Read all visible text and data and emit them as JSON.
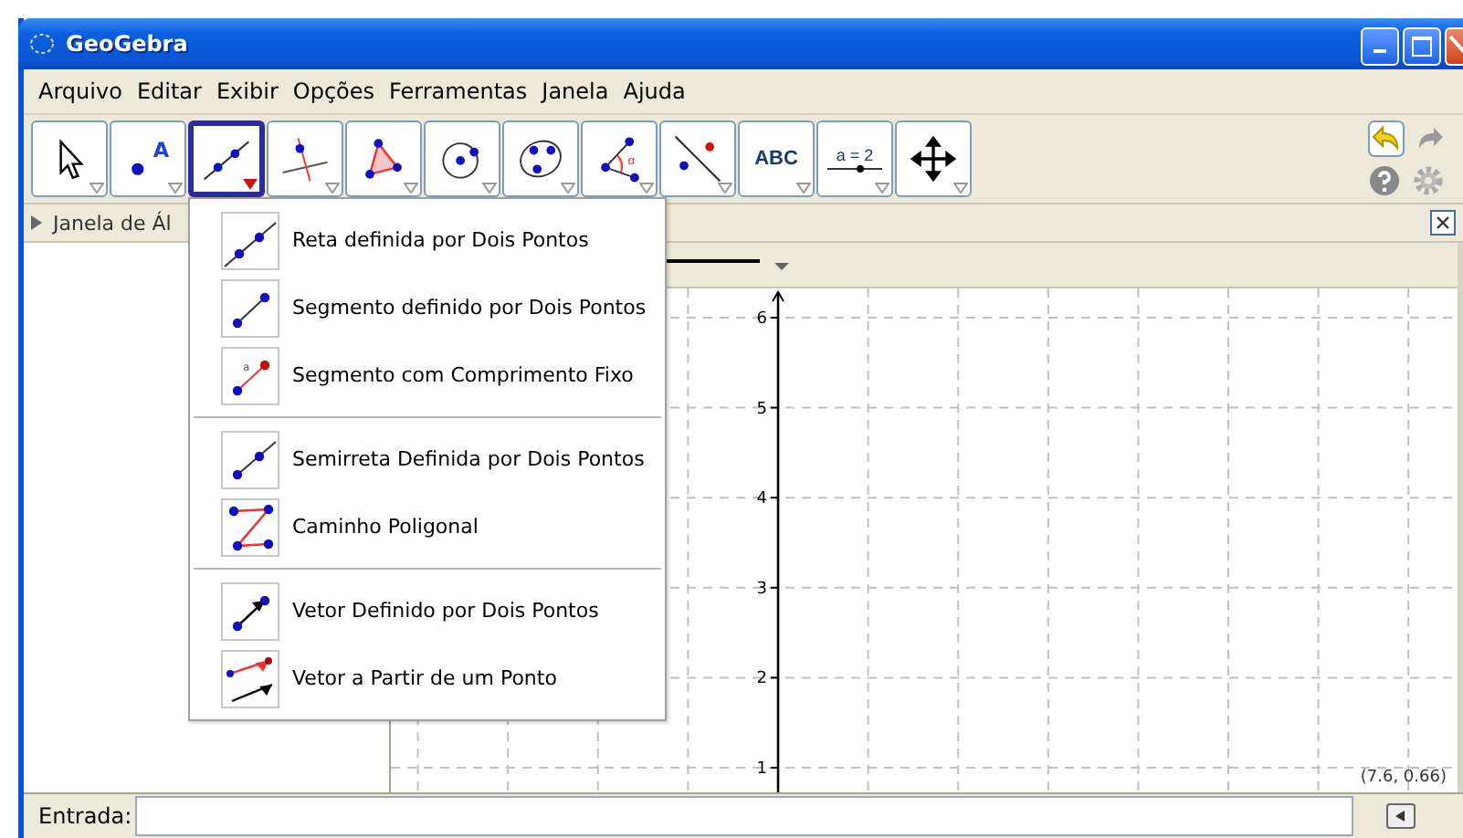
{
  "window": {
    "title": "GeoGebra"
  },
  "menu": [
    "Arquivo",
    "Editar",
    "Exibir",
    "Opções",
    "Ferramentas",
    "Janela",
    "Ajuda"
  ],
  "tools": [
    {
      "kind": "move",
      "selected": false
    },
    {
      "kind": "point",
      "icon_text": "A",
      "selected": false
    },
    {
      "kind": "line",
      "selected": true
    },
    {
      "kind": "perpendicular",
      "selected": false
    },
    {
      "kind": "polygon",
      "selected": false
    },
    {
      "kind": "circle",
      "selected": false
    },
    {
      "kind": "conic",
      "selected": false
    },
    {
      "kind": "angle",
      "icon_text": "α",
      "selected": false
    },
    {
      "kind": "reflect",
      "selected": false
    },
    {
      "kind": "text",
      "label": "ABC",
      "selected": false
    },
    {
      "kind": "slider",
      "label": "a = 2",
      "selected": false
    },
    {
      "kind": "move_view",
      "selected": false
    }
  ],
  "tool_menu": {
    "groups": [
      [
        {
          "kind": "line",
          "label": "Reta definida por Dois Pontos"
        },
        {
          "kind": "segment",
          "label": "Segmento definido por Dois Pontos"
        },
        {
          "kind": "segment_fixed",
          "icon_text": "a",
          "label": "Segmento com Comprimento Fixo"
        }
      ],
      [
        {
          "kind": "ray",
          "label": "Semirreta Definida por Dois Pontos"
        },
        {
          "kind": "polyline",
          "label": "Caminho Poligonal"
        }
      ],
      [
        {
          "kind": "vector",
          "label": "Vetor Definido por Dois Pontos"
        },
        {
          "kind": "vector_from_point",
          "label": "Vetor a Partir de um Ponto"
        }
      ]
    ]
  },
  "algebra_view": {
    "title": "Janela de Ál"
  },
  "graphics": {
    "y_tick_labels": [
      "6",
      "5",
      "4",
      "3",
      "2",
      "1"
    ],
    "coordinates": "(7.6, 0.66)"
  },
  "input_bar": {
    "label": "Entrada:"
  }
}
